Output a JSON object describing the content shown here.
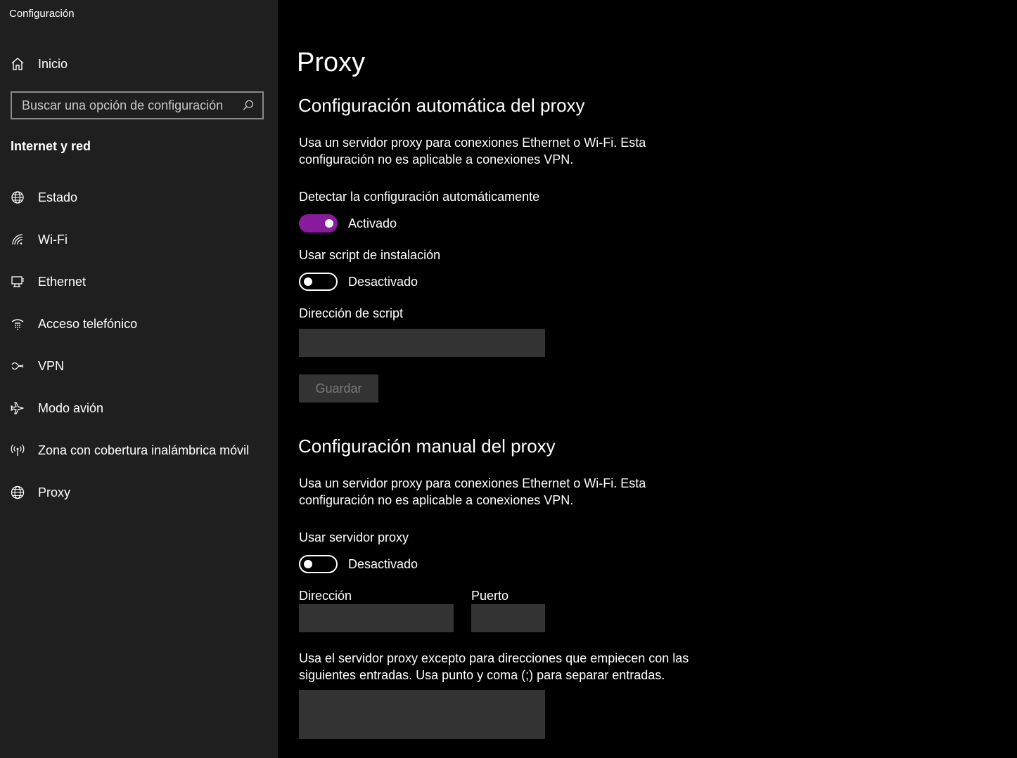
{
  "app": {
    "title": "Configuración"
  },
  "sidebar": {
    "home_label": "Inicio",
    "search_placeholder": "Buscar una opción de configuración",
    "section_title": "Internet y red",
    "items": [
      {
        "label": "Estado",
        "icon": "globe-status-icon"
      },
      {
        "label": "Wi-Fi",
        "icon": "wifi-icon"
      },
      {
        "label": "Ethernet",
        "icon": "ethernet-icon"
      },
      {
        "label": "Acceso telefónico",
        "icon": "dialup-icon"
      },
      {
        "label": "VPN",
        "icon": "vpn-icon"
      },
      {
        "label": "Modo avión",
        "icon": "airplane-icon"
      },
      {
        "label": "Zona con cobertura inalámbrica móvil",
        "icon": "hotspot-icon"
      },
      {
        "label": "Proxy",
        "icon": "globe-icon"
      }
    ]
  },
  "main": {
    "page_title": "Proxy",
    "auto": {
      "heading": "Configuración automática del proxy",
      "description": "Usa un servidor proxy para conexiones Ethernet o Wi-Fi. Esta configuración no es aplicable a conexiones VPN.",
      "detect_label": "Detectar la configuración automáticamente",
      "detect_state": "Activado",
      "detect_on": true,
      "script_label": "Usar script de instalación",
      "script_state": "Desactivado",
      "script_on": false,
      "script_address_label": "Dirección de script",
      "script_address_value": "",
      "save_label": "Guardar"
    },
    "manual": {
      "heading": "Configuración manual del proxy",
      "description": "Usa un servidor proxy para conexiones Ethernet o Wi-Fi. Esta configuración no es aplicable a conexiones VPN.",
      "use_proxy_label": "Usar servidor proxy",
      "use_proxy_state": "Desactivado",
      "use_proxy_on": false,
      "address_label": "Dirección",
      "address_value": "",
      "port_label": "Puerto",
      "port_value": "",
      "exceptions_description": "Usa el servidor proxy excepto para direcciones que empiecen con las siguientes entradas. Usa punto y coma (;) para separar entradas.",
      "exceptions_value": ""
    }
  },
  "colors": {
    "sidebar_bg": "#1f1f1f",
    "main_bg": "#000000",
    "accent": "#8a1a9e",
    "textbox_bg": "#333333"
  }
}
